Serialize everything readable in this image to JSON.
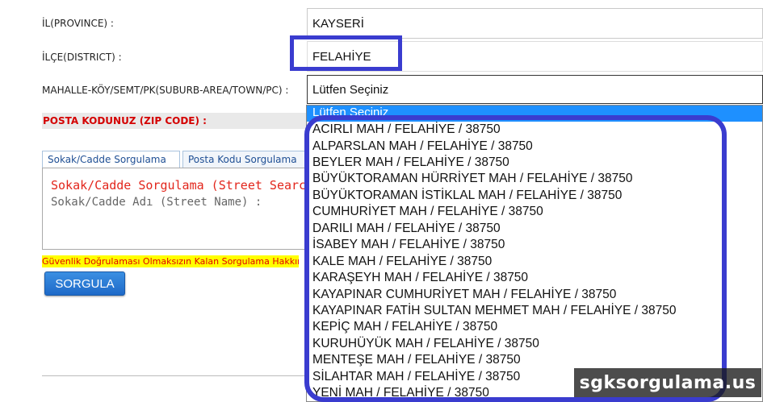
{
  "form": {
    "province_label": "İL(PROVINCE) :",
    "province_value": "KAYSERİ",
    "district_label": "İLÇE(DISTRICT) :",
    "district_value": "FELAHİYE",
    "suburb_label": "MAHALLE-KÖY/SEMT/PK(SUBURB-AREA/TOWN/PC) :",
    "suburb_value": "Lütfen Seçiniz",
    "zip_label": "POSTA KODUNUZ (ZIP CODE) :"
  },
  "tabs": [
    {
      "label": "Sokak/Cadde Sorgulama"
    },
    {
      "label": "Posta Kodu Sorgulama"
    }
  ],
  "panel": {
    "title": "Sokak/Cadde Sorgulama (Street Search",
    "subtitle": "Sokak/Cadde Adı (Street Name) :"
  },
  "warning": "Güvenlik Doğrulaması Olmaksızın Kalan Sorgulama Hakkınız",
  "button": {
    "label": "SORGULA"
  },
  "dropdown": {
    "selected": "Lütfen Seçiniz",
    "options": [
      "ACIRLI MAH / FELAHİYE / 38750",
      "ALPARSLAN MAH / FELAHİYE / 38750",
      "BEYLER MAH / FELAHİYE / 38750",
      "BÜYÜKTORAMAN HÜRRİYET MAH / FELAHİYE / 38750",
      "BÜYÜKTORAMAN İSTİKLAL MAH / FELAHİYE / 38750",
      "CUMHURİYET MAH / FELAHİYE / 38750",
      "DARILI MAH / FELAHİYE / 38750",
      "İSABEY MAH / FELAHİYE / 38750",
      "KALE MAH / FELAHİYE / 38750",
      "KARAŞEYH MAH / FELAHİYE / 38750",
      "KAYAPINAR CUMHURİYET MAH / FELAHİYE / 38750",
      "KAYAPINAR FATİH SULTAN MEHMET MAH / FELAHİYE / 38750",
      "KEPİÇ MAH / FELAHİYE / 38750",
      "KURUHÜYÜK MAH / FELAHİYE / 38750",
      "MENTEŞE MAH / FELAHİYE / 38750",
      "SİLAHTAR MAH / FELAHİYE / 38750",
      "YENİ MAH / FELAHİYE / 38750"
    ]
  },
  "watermark": "sgksorgulama.us",
  "colors": {
    "highlight": "#3a3ccf",
    "selected_option": "#1e90ff",
    "zip_label": "#d40000",
    "button": "#1f6ac8",
    "warning_bg": "#ffff00"
  }
}
